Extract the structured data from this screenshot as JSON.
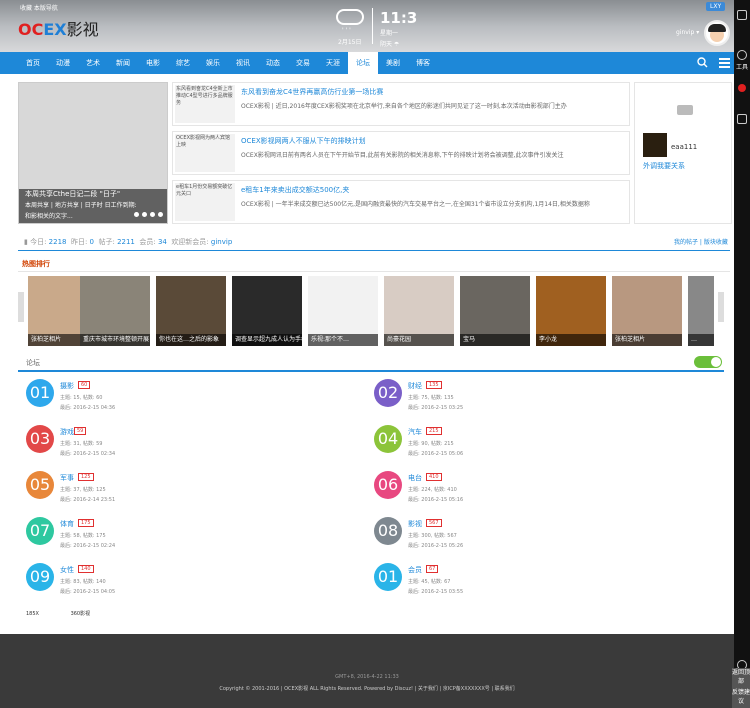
{
  "header": {
    "mini_links": "收藏  本版导航",
    "logo": {
      "oc": "OC",
      "ex": "EX",
      "ys": "影视"
    },
    "weather": {
      "date": "2月15日",
      "time": "11:3",
      "line1": "星期一",
      "line2": "阴天 ☂"
    },
    "badge": "LXY",
    "user": "ginvip ▾"
  },
  "nav": {
    "items": [
      "首页",
      "动漫",
      "艺术",
      "新闻",
      "电影",
      "综艺",
      "娱乐",
      "视讯",
      "动态",
      "交易",
      "天涯",
      "论坛",
      "美剧",
      "博客"
    ],
    "active": "论坛"
  },
  "slider": {
    "caption_title": "本周共享Cthe日记二段 \"日子\"",
    "caption_sub": "本周共享 | 地方共享 | 日子时  日工作到期:",
    "caption_sub2": "和影相关的文字..."
  },
  "news": [
    {
      "thumb": "东风看到奋龙C4全新上市推动C4型号进行多品牌服务",
      "title": "东风看到奋龙C4世界再赢高仿行业第一场比赛",
      "desc": "OCEX影视 | 近日,2016年度CEX影视奖项在北京举行,来自各个地区的影迷们共同见证了这一时刻,本次活动由影视部门主办"
    },
    {
      "thumb": "OCEX影视网为两人宾馆上映",
      "title": "OCEX影视网两人不服从下午的排映计划",
      "desc": "OCEX影视网讯日前有两名人员在下午开始节目,此前有关影院的相关消息称,下午的排映计划将会被调整,此次事件引发关注"
    },
    {
      "thumb": "e租车1月份交易额突破亿元关口",
      "title": "e租车1年来卖出成交额达500亿,夹",
      "desc": "OCEX影视 | 一年半来成交额已达500亿元,是国内融资最快的汽车交易平台之一,在全国31个省市设立分支机构,1月14日,相关数据称"
    }
  ],
  "rightbox": {
    "username": "eaa111",
    "link": "外调我要关系"
  },
  "stats": {
    "today_label": "今日: ",
    "today": "2218",
    "yesterday_label": "昨日: ",
    "yesterday": "0",
    "posts_label": "帖子: ",
    "posts": "2211",
    "members_label": "会员: ",
    "members": "34",
    "newest_label": "欢迎新会员: ",
    "newest": "ginvip",
    "right": "我的帖子 | 版块收藏"
  },
  "hot": {
    "title": "热图排行",
    "items": [
      "张柏芝相片",
      "重庆市城市环境整顿开展",
      "你也在这…之后的影象",
      "调查显示超九成人认为手机费太高",
      "乐视:那个不…",
      "尚豪花园",
      "宝马",
      "李小龙",
      "张柏芝相片",
      "…"
    ]
  },
  "forum": {
    "title": "论坛",
    "boards": [
      {
        "num": "01",
        "name": "摄影",
        "badge": "60",
        "meta1": "主题: 15, 帖数: 60",
        "meta2": "最后: 2016-2-15 04:36",
        "color": "#2ea8ec"
      },
      {
        "num": "02",
        "name": "财经",
        "badge": "135",
        "meta1": "主题: 75, 帖数: 135",
        "meta2": "最后: 2016-2-15 03:25",
        "color": "#7a5fc8"
      },
      {
        "num": "03",
        "name": "游戏",
        "badge": "59",
        "meta1": "主题: 31, 帖数: 59",
        "meta2": "最后: 2016-2-15 02:34",
        "color": "#e24848"
      },
      {
        "num": "04",
        "name": "汽车",
        "badge": "215",
        "meta1": "主题: 90, 帖数: 215",
        "meta2": "最后: 2016-2-15 05:06",
        "color": "#8cc43a"
      },
      {
        "num": "05",
        "name": "军事",
        "badge": "125",
        "meta1": "主题: 37, 帖数: 125",
        "meta2": "最后: 2016-2-14 23:51",
        "color": "#e8873a"
      },
      {
        "num": "06",
        "name": "电台",
        "badge": "410",
        "meta1": "主题: 224, 帖数: 410",
        "meta2": "最后: 2016-2-15 05:16",
        "color": "#e84880"
      },
      {
        "num": "07",
        "name": "体育",
        "badge": "175",
        "meta1": "主题: 58, 帖数: 175",
        "meta2": "最后: 2016-2-15 02:24",
        "color": "#2ec8a0"
      },
      {
        "num": "08",
        "name": "影视",
        "badge": "567",
        "meta1": "主题: 300, 帖数: 567",
        "meta2": "最后: 2016-2-15 05:26",
        "color": "#7e8890"
      },
      {
        "num": "09",
        "name": "女性",
        "badge": "140",
        "meta1": "主题: 83, 帖数: 140",
        "meta2": "最后: 2016-2-15 04:05",
        "color": "#2ab4e8"
      },
      {
        "num": "01",
        "name": "会员",
        "badge": "67",
        "meta1": "主题: 45, 帖数: 67",
        "meta2": "最后: 2016-2-15 03:55",
        "color": "#2ab4e8"
      }
    ]
  },
  "foot_links": [
    "185X",
    "360影视"
  ],
  "footer": {
    "line1": "GMT+8, 2016-4-22 11:33",
    "line2": "Copyright © 2001-2016  |  OCEX影视  ALL Rights Reserved.  Powered by Discuz!  |  关于我们  |  京ICP备XXXXXXX号  |  联系我们"
  },
  "sidebar": {
    "btn1": "返回顶部",
    "btn2": "反馈建议"
  }
}
